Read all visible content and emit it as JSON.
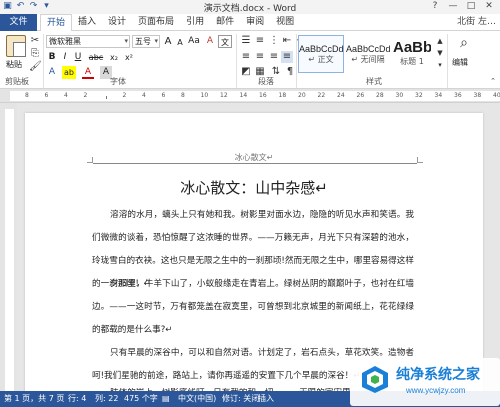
{
  "titlebar": {
    "title": "演示文档.docx - Word",
    "qat_icons": [
      "save-icon",
      "undo-icon",
      "redo-icon",
      "customize-icon"
    ],
    "window_buttons": [
      "?",
      "—",
      "□",
      "✕"
    ]
  },
  "tabs": {
    "file": "文件",
    "items": [
      "开始",
      "插入",
      "设计",
      "页面布局",
      "引用",
      "邮件",
      "审阅",
      "视图"
    ],
    "active": "开始",
    "user": "北街 左…"
  },
  "ribbon": {
    "clipboard": {
      "paste": "粘贴",
      "group": "剪贴板"
    },
    "font": {
      "font_name": "微软雅黑",
      "font_size": "五号",
      "grow": "A",
      "shrink": "A",
      "case": "Aa",
      "clear": "A",
      "bold": "B",
      "italic": "I",
      "underline": "U",
      "strike": "abc",
      "sub": "x₂",
      "sup": "x²",
      "effects": "A",
      "highlight": "ab",
      "color": "A",
      "phonetic": "文",
      "border": "A",
      "group": "字体"
    },
    "paragraph": {
      "group": "段落"
    },
    "styles": {
      "items": [
        {
          "sample": "AaBbCcDd",
          "name": "↵ 正文"
        },
        {
          "sample": "AaBbCcDd",
          "name": "↵ 无间隔"
        },
        {
          "sample": "AaBb",
          "name": "标题 1"
        }
      ],
      "group": "样式"
    },
    "editing": {
      "label": "编辑"
    }
  },
  "ruler": {
    "numbers": [
      "8",
      "6",
      "4",
      "2",
      "",
      "2",
      "4",
      "6",
      "8",
      "10",
      "12",
      "14",
      "16",
      "18",
      "20",
      "22",
      "24",
      "26",
      "28",
      "30",
      "32",
      "34",
      "36",
      "38",
      "40"
    ]
  },
  "document": {
    "header": "冰心散文↵",
    "title": "冰心散文：山中杂感↵",
    "paragraphs": [
      "溶溶的水月，螭头上只有她和我。树影里对面水边，隐隐的听见水声和笑语。我们微微的谈着，恐怕惊醒了这浓睡的世界。——万籁无声，月光下只有深碧的池水，玲珑雪白的衣袂。这也只是无限之生中的一刹那顷!然而无限之生中，哪里容易得这样的一刹那顷！↵",
      "夕阳里，牛羊下山了，小蚁般缘走在青岩上。绿树丛阴的巅巅叶子，也衬在红墙边。——一这时节，万有都笼盖在寂寞里，可曾想到北京城里的新闻纸上，花花绿绿的都载的是什么事?↵",
      "只有早晨的深谷中，可以和自然对语。计划定了，岩石点头，草花欢笑。造物者呵!我们星驰的前途，路站上，请你再遥遥的安置下几个早晨的深谷！↵",
      "肢体的岩上，树影底线叮，日有我的和一切……一无限的宇宙里"
    ]
  },
  "status": {
    "page": "第 1 页，共 7 页",
    "chars": "行: 4",
    "col": "列: 22",
    "words": "475 个字",
    "lang": "中文(中国)",
    "track": "修订: 关闭",
    "mode": "插入"
  },
  "watermark": {
    "title": "纯净系统之家",
    "url": "www.ycwjzy.com"
  },
  "colors": {
    "accent": "#2b579a",
    "watermark": "#1a7fd6"
  }
}
